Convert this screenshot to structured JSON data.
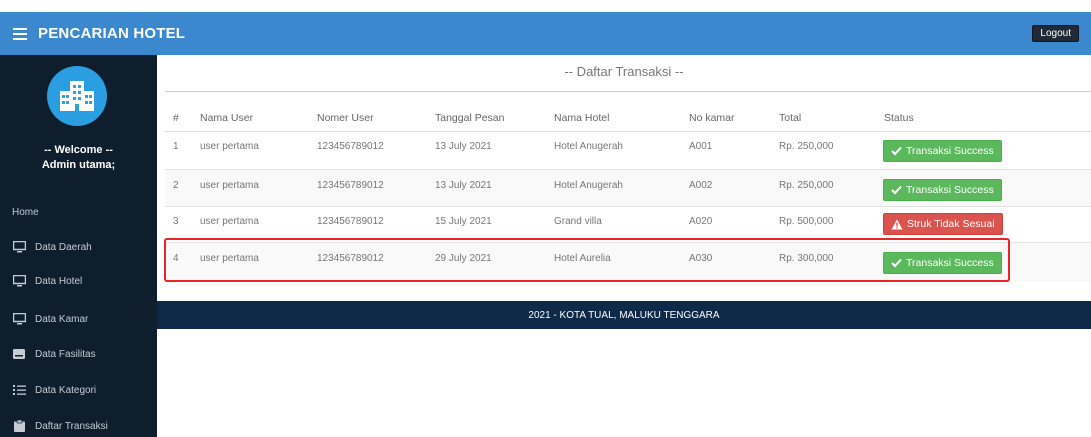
{
  "header": {
    "title": "PENCARIAN HOTEL",
    "logout_label": "Logout",
    "color": "#3c88cf"
  },
  "sidebar": {
    "welcome": "-- Welcome --",
    "user": "Admin utama;",
    "avatar_icon": "hotel-building-icon",
    "items": [
      {
        "label": "Home",
        "icon": ""
      },
      {
        "label": "Data Daerah",
        "icon": "monitor-icon"
      },
      {
        "label": "Data Hotel",
        "icon": "monitor-icon"
      },
      {
        "label": "Data Kamar",
        "icon": "monitor-icon"
      },
      {
        "label": "Data Fasilitas",
        "icon": "card-icon"
      },
      {
        "label": "Data Kategori",
        "icon": "list-icon"
      },
      {
        "label": "Daftar Transaksi",
        "icon": "clipboard-icon"
      }
    ]
  },
  "main": {
    "heading": "-- Daftar Transaksi --",
    "table": {
      "columns": [
        "#",
        "Nama User",
        "Nomer User",
        "Tanggal Pesan",
        "Nama Hotel",
        "No kamar",
        "Total",
        "Status"
      ],
      "rows": [
        {
          "no": "1",
          "user": "user pertama",
          "phone": "123456789012",
          "date": "13 July 2021",
          "hotel": "Hotel Anugerah",
          "room": "A001",
          "total": "Rp. 250,000",
          "status": "Transaksi Success",
          "status_type": "success"
        },
        {
          "no": "2",
          "user": "user pertama",
          "phone": "123456789012",
          "date": "13 July 2021",
          "hotel": "Hotel Anugerah",
          "room": "A002",
          "total": "Rp. 250,000",
          "status": "Transaksi Success",
          "status_type": "success"
        },
        {
          "no": "3",
          "user": "user pertama",
          "phone": "123456789012",
          "date": "15 July 2021",
          "hotel": "Grand villa",
          "room": "A020",
          "total": "Rp. 500,000",
          "status": "Struk Tidak Sesuai",
          "status_type": "danger"
        },
        {
          "no": "4",
          "user": "user pertama",
          "phone": "123456789012",
          "date": "29 July 2021",
          "hotel": "Hotel Aurelia",
          "room": "A030",
          "total": "Rp. 300,000",
          "status": "Transaksi Success",
          "status_type": "success"
        }
      ]
    }
  },
  "footer": {
    "text": "2021 - KOTA TUAL, MALUKU TENGGARA"
  },
  "colors": {
    "success": "#5cb85c",
    "danger": "#d9534f",
    "sidebar": "#0f1e2d",
    "footer": "#0f2a48",
    "highlight": "#e52727"
  }
}
